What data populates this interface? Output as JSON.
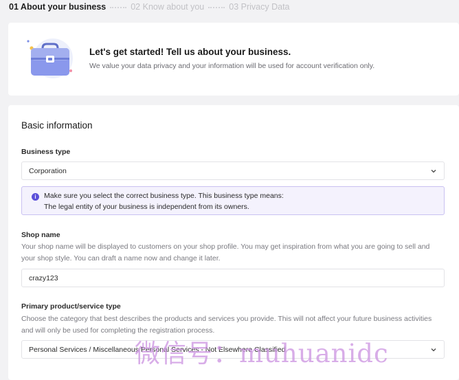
{
  "stepper": {
    "steps": [
      {
        "label": "01 About your business",
        "active": true
      },
      {
        "label": "02 Know about you",
        "active": false
      },
      {
        "label": "03 Privacy Data",
        "active": false
      }
    ]
  },
  "intro": {
    "icon": "briefcase-icon",
    "title": "Let's get started! Tell us about your business.",
    "description": "We value your data privacy and your information will be used for account verification only."
  },
  "form": {
    "section_title": "Basic information",
    "business_type": {
      "label": "Business type",
      "value": "Corporation",
      "info_line1": "Make sure you select the correct business type. This business type means:",
      "info_line2": "The legal entity of your business is independent from its owners."
    },
    "shop_name": {
      "label": "Shop name",
      "help": "Your shop name will be displayed to customers on your shop profile. You may get inspiration from what you are going to sell and your shop style. You can draft a name now and change it later.",
      "value": "crazy123"
    },
    "primary_product": {
      "label": "Primary product/service type",
      "help": "Choose the category that best describes the products and services you provide. This will not affect your future business activities and will only be used for completing the registration process.",
      "value": "Personal Services / Miscellaneous Personal Services - Not Elsewhere Classified"
    }
  },
  "watermark": "微信号：muhuanidc",
  "colors": {
    "accent": "#5b4fd9",
    "info_bg": "#f4f2fd",
    "info_border": "#c9c1f1",
    "page_bg": "#f2f2f4"
  }
}
